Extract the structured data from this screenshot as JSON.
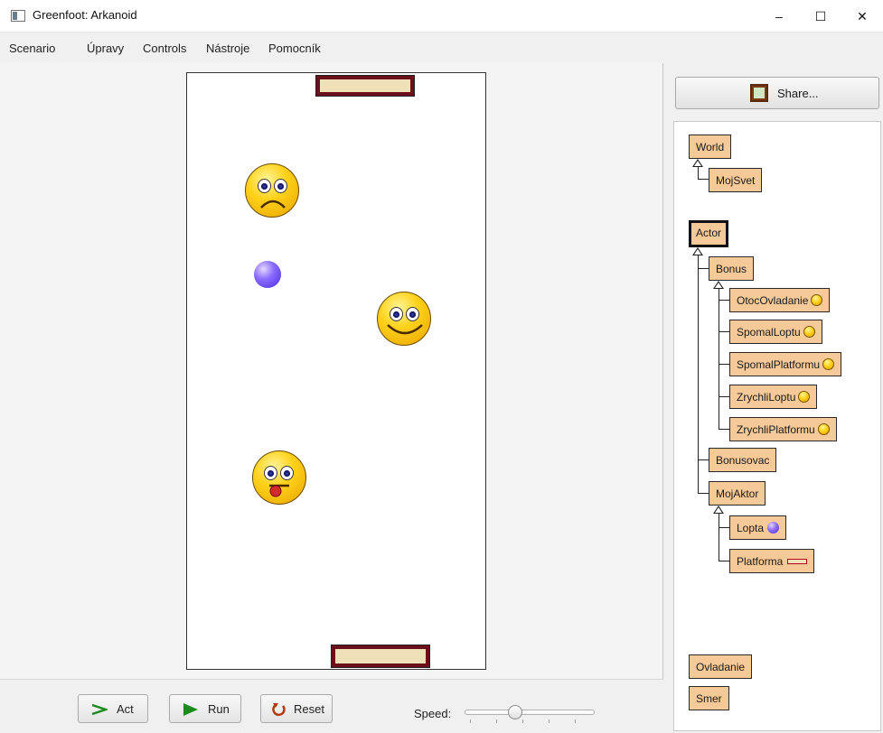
{
  "window": {
    "title": "Greenfoot: Arkanoid",
    "minimize": "–",
    "maximize": "☐",
    "close": "✕"
  },
  "menu": [
    "Scenario",
    "Úpravy",
    "Controls",
    "Nástroje",
    "Pomocník"
  ],
  "controls": {
    "act": "Act",
    "run": "Run",
    "reset": "Reset",
    "speed_label": "Speed:",
    "speed_value": 0.4
  },
  "share": {
    "label": "Share..."
  },
  "classes": {
    "world": "World",
    "moj_svet": "MojSvet",
    "actor": "Actor",
    "bonus": "Bonus",
    "otoc_ovladanie": "OtocOvladanie",
    "spomal_loptu": "SpomalLoptu",
    "spomal_platformu": "SpomalPlatformu",
    "zrychli_loptu": "ZrychliLoptu",
    "zrychli_platformu": "ZrychliPlatformu",
    "bonusovac": "Bonusovac",
    "moj_aktor": "MojAktor",
    "lopta": "Lopta",
    "platforma": "Platforma",
    "ovladanie": "Ovladanie",
    "smer": "Smer"
  },
  "colors": {
    "class_box": "#f6c998",
    "paddle_border": "#6b0f1a",
    "paddle_fill": "#f0e0b8"
  }
}
